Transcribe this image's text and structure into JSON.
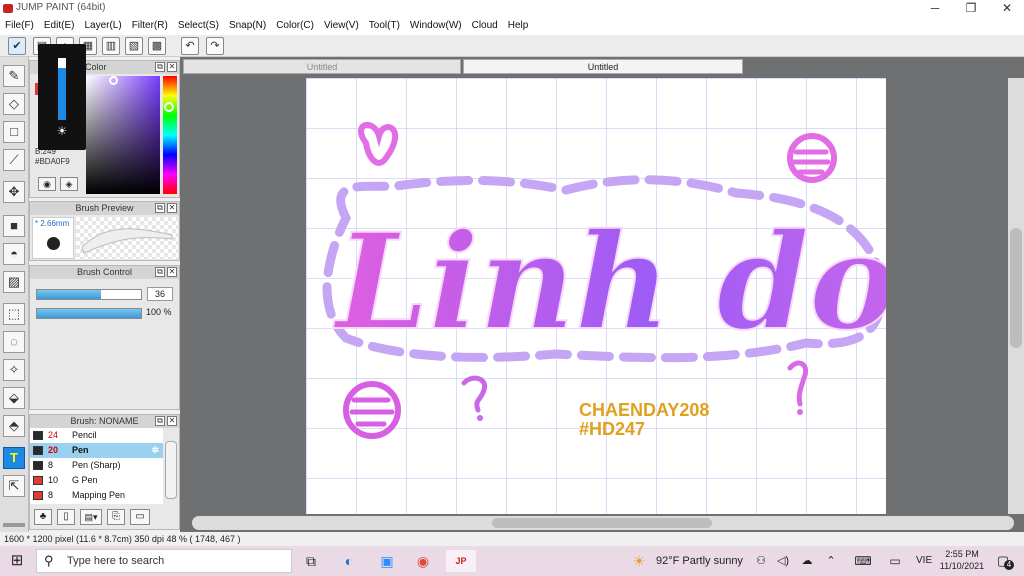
{
  "window": {
    "title": "JUMP PAINT (64bit)"
  },
  "menu": [
    "File(F)",
    "Edit(E)",
    "Layer(L)",
    "Filter(R)",
    "Select(S)",
    "Snap(N)",
    "Color(C)",
    "View(V)",
    "Tool(T)",
    "Window(W)",
    "Cloud",
    "Help"
  ],
  "tabs": [
    {
      "label": "Untitled",
      "active": false
    },
    {
      "label": "Untitled",
      "active": true
    }
  ],
  "color_panel": {
    "title": "Color",
    "b_value": "B:249",
    "hex": "#BDA0F9"
  },
  "brush_preview": {
    "title": "Brush Preview",
    "size": "* 2.66mm"
  },
  "brush_control": {
    "title": "Brush Control",
    "size_value": "36",
    "opacity_value": "100 %",
    "size_fill": 0.62,
    "opacity_fill": 1.0
  },
  "brush_list": {
    "title": "Brush: NONAME",
    "items": [
      {
        "size": "24",
        "name": "Pencil",
        "color": "#2a2a2a",
        "selected": false
      },
      {
        "size": "20",
        "name": "Pen",
        "color": "#2a2a2a",
        "selected": true
      },
      {
        "size": "8",
        "name": "Pen (Sharp)",
        "color": "#2a2a2a",
        "selected": false
      },
      {
        "size": "10",
        "name": "G Pen",
        "color": "#e53935",
        "selected": false
      },
      {
        "size": "8",
        "name": "Mapping Pen",
        "color": "#e53935",
        "selected": false
      }
    ]
  },
  "artwork": {
    "signature_line1": "CHAENDAY208",
    "signature_line2": "#HD247",
    "main_text": "Linh dou"
  },
  "status": {
    "text": "1600 * 1200 pixel   (11.6 * 8.7cm)   350 dpi   48 %   ( 1748, 467 )"
  },
  "taskbar": {
    "search_placeholder": "Type here to search",
    "weather": "92°F  Partly sunny",
    "lang": "VIE",
    "time": "2:55 PM",
    "date": "11/10/2021",
    "notif_count": "4"
  },
  "colors": {
    "accent": "#1e88e5",
    "canvas_bg": "#6e7072",
    "ink_purple": "#9b5cf6",
    "ink_pink": "#e05fe0",
    "gold": "#e0a020"
  }
}
